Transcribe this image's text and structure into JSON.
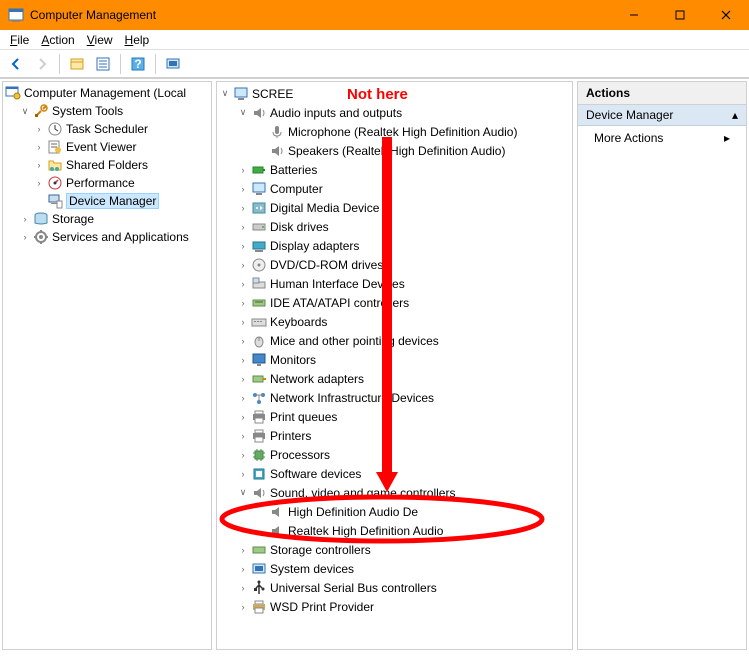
{
  "window": {
    "title": "Computer Management"
  },
  "menu": {
    "file": "File",
    "action": "Action",
    "view": "View",
    "help": "Help"
  },
  "leftTree": {
    "root": "Computer Management (Local",
    "systemTools": "System Tools",
    "taskScheduler": "Task Scheduler",
    "eventViewer": "Event Viewer",
    "sharedFolders": "Shared Folders",
    "performance": "Performance",
    "deviceManager": "Device Manager",
    "storage": "Storage",
    "services": "Services and Applications"
  },
  "center": {
    "root": "SCREE",
    "audioIO": "Audio inputs and outputs",
    "microphone": "Microphone (Realtek High Definition Audio)",
    "speakers": "Speakers (Realtek High Definition Audio)",
    "batteries": "Batteries",
    "computer": "Computer",
    "digitalMedia": "Digital Media Device",
    "diskDrives": "Disk drives",
    "displayAdapters": "Display adapters",
    "dvd": "DVD/CD-ROM drives",
    "hid": "Human Interface Devices",
    "ide": "IDE ATA/ATAPI controllers",
    "keyboards": "Keyboards",
    "mice": "Mice and other pointing devices",
    "monitors": "Monitors",
    "networkAdapters": "Network adapters",
    "networkInfra": "Network Infrastructure Devices",
    "printQueues": "Print queues",
    "printers": "Printers",
    "processors": "Processors",
    "software": "Software devices",
    "sound": "Sound, video and game controllers",
    "hdAudio": "High Definition Audio De",
    "realtek": "Realtek High Definition Audio",
    "storageCtrl": "Storage controllers",
    "systemDevices": "System devices",
    "usb": "Universal Serial Bus controllers",
    "wsd": "WSD Print Provider"
  },
  "actions": {
    "header": "Actions",
    "section": "Device Manager",
    "more": "More Actions"
  },
  "annotations": {
    "notHere": "Not here"
  }
}
